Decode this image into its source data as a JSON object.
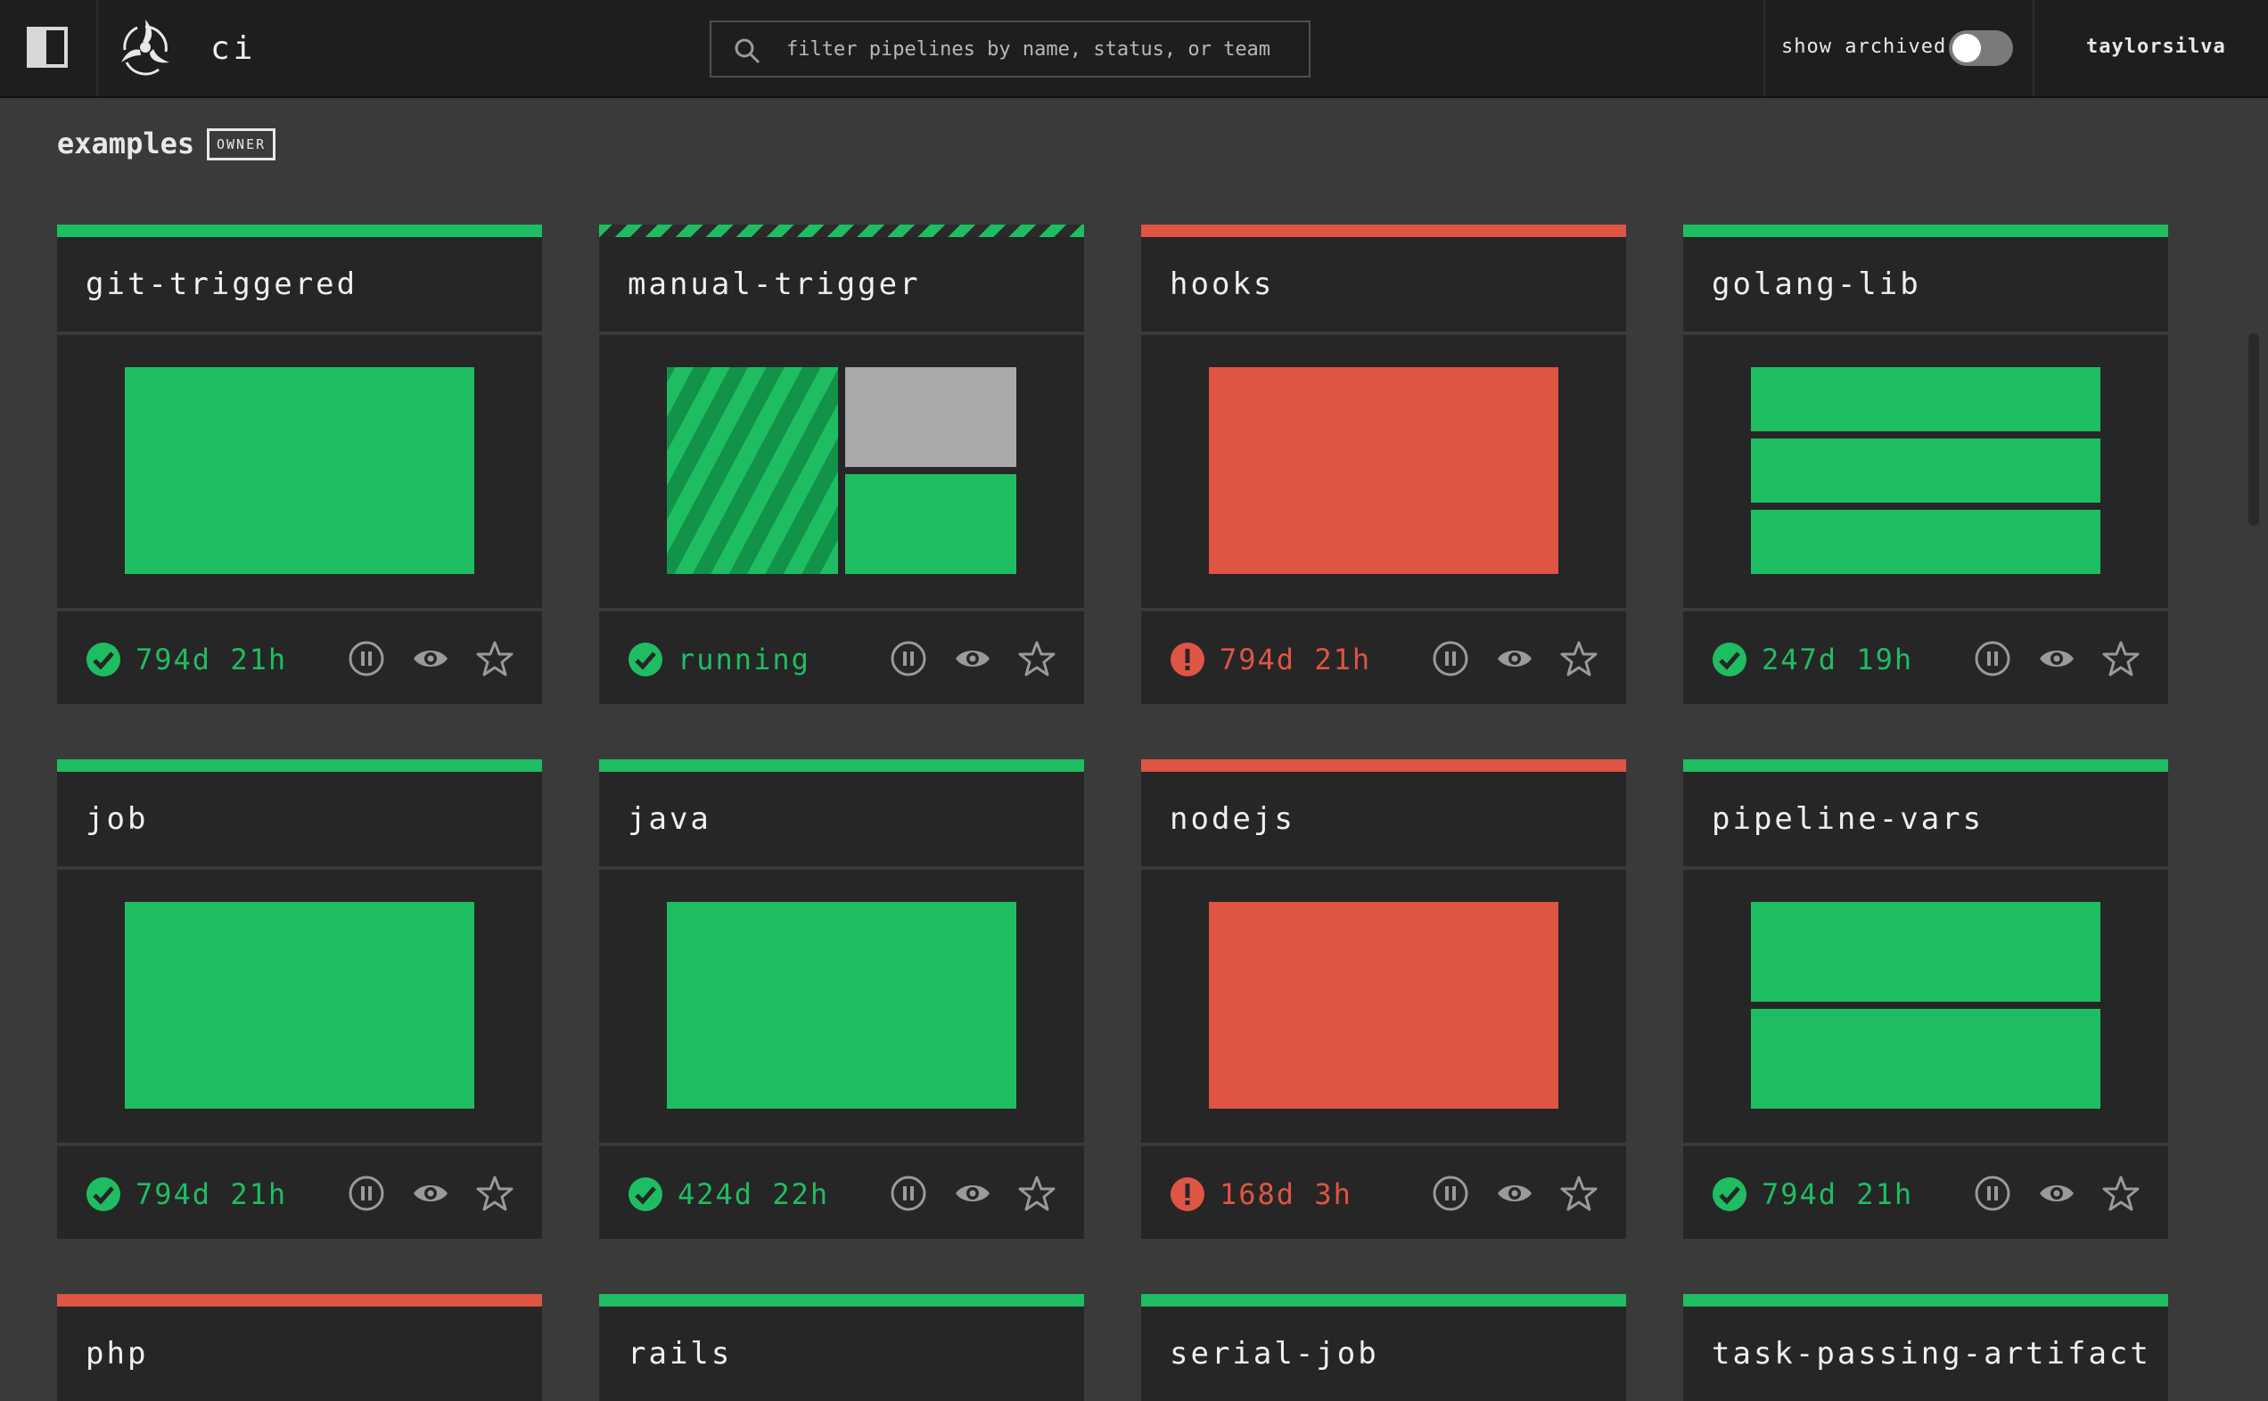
{
  "header": {
    "team_name": "ci",
    "search_placeholder": "filter pipelines by name, status, or team",
    "show_archived_label": "show archived",
    "show_archived": false,
    "username": "taylorsilva"
  },
  "group": {
    "name": "examples",
    "role": "OWNER"
  },
  "colors": {
    "succeeded": "#1fbd61",
    "failed": "#de5543",
    "pending": "#a9a9a9"
  },
  "pipelines": [
    {
      "name": "git-triggered",
      "status_text": "794d 21h"
    },
    {
      "name": "manual-trigger",
      "status_text": "running"
    },
    {
      "name": "hooks",
      "status_text": "794d 21h"
    },
    {
      "name": "golang-lib",
      "status_text": "247d 19h"
    },
    {
      "name": "job",
      "status_text": "794d 21h"
    },
    {
      "name": "java",
      "status_text": "424d 22h"
    },
    {
      "name": "nodejs",
      "status_text": "168d 3h"
    },
    {
      "name": "pipeline-vars",
      "status_text": "794d 21h"
    },
    {
      "name": "php"
    },
    {
      "name": "rails"
    },
    {
      "name": "serial-job"
    },
    {
      "name": "task-passing-artifact"
    }
  ]
}
